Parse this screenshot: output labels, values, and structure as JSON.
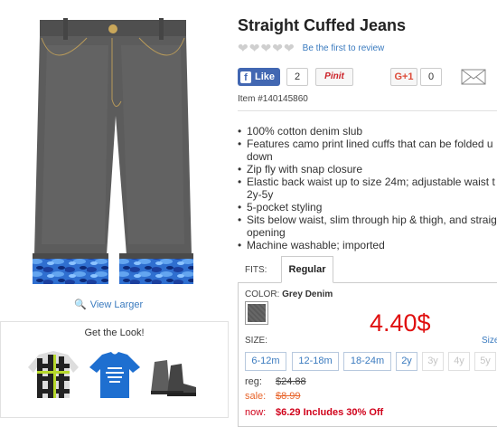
{
  "product": {
    "title": "Straight Cuffed Jeans",
    "review_link": "Be the first to review",
    "rating_stars": 5,
    "rating_value": 0,
    "item_number": "Item #140145860",
    "view_larger": "View Larger"
  },
  "social": {
    "like_label": "Like",
    "like_count": "2",
    "pinit_label": "Pinit",
    "gplus_label": "G+1",
    "gplus_count": "0"
  },
  "features": [
    "100% cotton denim slub",
    "Features camo print lined cuffs that can be folded u\ndown",
    "Zip fly with snap closure",
    "Elastic back waist up to size 24m; adjustable waist t\n2y-5y",
    "5-pocket styling",
    "Sits below waist, slim through hip & thigh, and straig\nopening",
    "Machine washable; imported"
  ],
  "fits": {
    "label": "FITS:",
    "tabs": [
      "Regular"
    ]
  },
  "color": {
    "label": "COLOR:",
    "value": "Grey Denim",
    "swatch_hex": "#5a5a5a"
  },
  "price_overlay": "4.40$",
  "sizes": {
    "label": "SIZE:",
    "guide_link": "Size",
    "options": [
      {
        "label": "6-12m",
        "available": true
      },
      {
        "label": "12-18m",
        "available": true
      },
      {
        "label": "18-24m",
        "available": true
      },
      {
        "label": "2y",
        "available": true
      },
      {
        "label": "3y",
        "available": false
      },
      {
        "label": "4y",
        "available": false
      },
      {
        "label": "5y",
        "available": false
      }
    ]
  },
  "pricing": {
    "reg_label": "reg:",
    "reg_price": "$24.88",
    "sale_label": "sale:",
    "sale_price": "$8.99",
    "now_label": "now:",
    "now_price": "$6.29   Includes 30% Off"
  },
  "get_the_look": {
    "title": "Get the Look!",
    "items": [
      "plaid-shirt-icon",
      "graphic-tee-icon",
      "boots-icon"
    ]
  },
  "colors": {
    "accent_link": "#3b7bbf",
    "facebook": "#4267b2",
    "price_red": "#e01010",
    "sale_orange": "#e8642a"
  }
}
